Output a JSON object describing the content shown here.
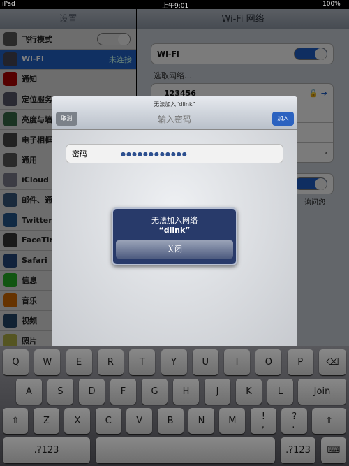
{
  "status": {
    "device": "iPad",
    "time": "上午9:01",
    "battery": "100%"
  },
  "sidebar": {
    "title": "设置",
    "items": [
      {
        "label": "飞行模式",
        "icon": "airplane-icon",
        "color": "#555",
        "toggle": "off"
      },
      {
        "label": "Wi-Fi",
        "icon": "wifi-icon",
        "color": "#445",
        "value": "未连接",
        "selected": true
      },
      {
        "label": "通知",
        "icon": "notifications-icon",
        "color": "#a00"
      },
      {
        "label": "定位服务",
        "icon": "location-icon",
        "color": "#556"
      },
      {
        "label": "亮度与墙纸",
        "icon": "brightness-icon",
        "color": "#364"
      },
      {
        "label": "电子相框",
        "icon": "picture-frame-icon",
        "color": "#444"
      },
      {
        "label": "通用",
        "icon": "gear-icon",
        "color": "#555"
      },
      {
        "label": "iCloud",
        "icon": "cloud-icon",
        "color": "#778"
      },
      {
        "label": "邮件、通讯录、日历",
        "icon": "mail-icon",
        "color": "#357"
      },
      {
        "label": "Twitter",
        "icon": "twitter-icon",
        "color": "#258"
      },
      {
        "label": "FaceTime",
        "icon": "facetime-icon",
        "color": "#333"
      },
      {
        "label": "Safari",
        "icon": "safari-icon",
        "color": "#247"
      },
      {
        "label": "信息",
        "icon": "messages-icon",
        "color": "#2a2"
      },
      {
        "label": "音乐",
        "icon": "music-icon",
        "color": "#c60"
      },
      {
        "label": "视频",
        "icon": "video-icon",
        "color": "#246"
      },
      {
        "label": "照片",
        "icon": "photos-icon",
        "color": "#aa4"
      }
    ]
  },
  "right": {
    "title": "Wi-Fi 网络",
    "wifi_label": "Wi-Fi",
    "wifi_toggle": "on",
    "choose_label": "选取网络…",
    "networks": [
      {
        "name": "123456"
      },
      {
        "name": ""
      },
      {
        "name": ""
      }
    ],
    "ask_text": "询问您",
    "ask_toggle": "on"
  },
  "modal": {
    "subtitle": "无法加入“dlink”",
    "title": "输入密码",
    "cancel": "取消",
    "join": "加入",
    "password_label": "密码",
    "password_value": "●●●●●●●●●●●●"
  },
  "alert": {
    "title": "无法加入网络",
    "name": "“dlink”",
    "close": "关闭"
  },
  "keyboard": {
    "row1": [
      "Q",
      "W",
      "E",
      "R",
      "T",
      "Y",
      "U",
      "I",
      "O",
      "P"
    ],
    "row2": [
      "A",
      "S",
      "D",
      "F",
      "G",
      "H",
      "J",
      "K",
      "L"
    ],
    "row3": [
      "Z",
      "X",
      "C",
      "V",
      "B",
      "N",
      "M",
      "!\n,",
      "?\n."
    ],
    "join": "Join",
    "numbers": ".?123",
    "delete": "⌫",
    "shift": "⇧",
    "hide": "⌨"
  }
}
